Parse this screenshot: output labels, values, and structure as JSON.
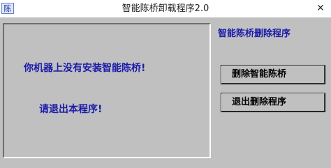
{
  "window": {
    "title": "智能陈桥卸载程序2.0",
    "icon_text": "陈",
    "close_glyph": "✕"
  },
  "panel": {
    "message_line1": "你机器上没有安装智能陈桥!",
    "message_line2": "请退出本程序!"
  },
  "sidebar": {
    "heading": "智能陈桥删除程序",
    "delete_button_label": "删除智能陈桥",
    "exit_button_label": "退出删除程序"
  },
  "colors": {
    "text_blue": "#1b1baa",
    "face": "#c0c0c0"
  }
}
